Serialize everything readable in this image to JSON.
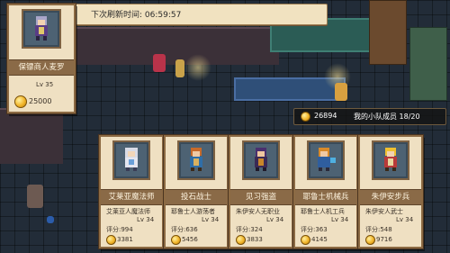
{
  "timer": {
    "label": "下次刷新时间:",
    "value": "06:59:57"
  },
  "featured": {
    "name": "保镖商人麦罗",
    "level": "Lv 35",
    "price": "25000"
  },
  "team": {
    "gold": "26894",
    "label": "我的小队成员",
    "count": "18/20"
  },
  "recruits": [
    {
      "name": "艾莱亚魔法师",
      "role": "艾莱亚人魔法师",
      "level": "Lv 34",
      "score": "评分:994",
      "price": "3381"
    },
    {
      "name": "投石战士",
      "role": "耶鲁士人游荡者",
      "level": "Lv 34",
      "score": "评分:636",
      "price": "5456"
    },
    {
      "name": "见习强盗",
      "role": "朱伊安人无职业",
      "level": "Lv 34",
      "score": "评分:324",
      "price": "3833"
    },
    {
      "name": "耶鲁士机械兵",
      "role": "耶鲁士人机工兵",
      "level": "Lv 34",
      "score": "评分:363",
      "price": "4145"
    },
    {
      "name": "朱伊安步兵",
      "role": "朱伊安人武士",
      "level": "Lv 34",
      "score": "评分:548",
      "price": "9716"
    }
  ],
  "colors": {
    "parchment": "#efe0c2",
    "frame": "#8c6a43",
    "coin": "#f2b52a"
  }
}
